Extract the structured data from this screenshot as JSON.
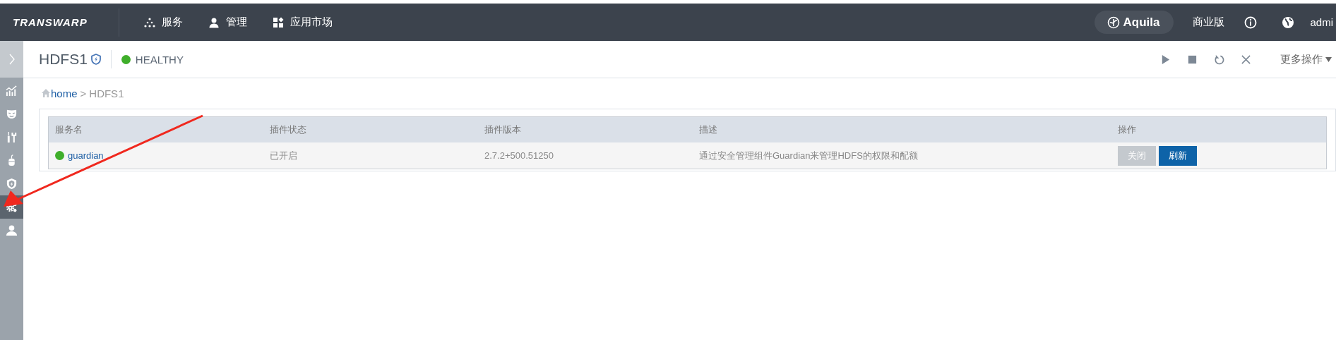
{
  "top_bar": {
    "logo": "TRANSWARP",
    "nav": [
      {
        "label": "服务"
      },
      {
        "label": "管理"
      },
      {
        "label": "应用市场"
      }
    ],
    "product": "Aquila",
    "edition": "商业版",
    "user": "admi"
  },
  "sidebar": {
    "items": [
      {
        "selected": false
      },
      {
        "selected": false
      },
      {
        "selected": false
      },
      {
        "selected": false
      },
      {
        "selected": false
      },
      {
        "selected": true
      },
      {
        "selected": false
      }
    ]
  },
  "header": {
    "title": "HDFS1",
    "status": "HEALTHY",
    "more": "更多操作"
  },
  "breadcrumb": {
    "home": "home",
    "separator": ">",
    "current": "HDFS1"
  },
  "table": {
    "columns": [
      "服务名",
      "插件状态",
      "插件版本",
      "描述",
      "操作"
    ],
    "rows": [
      {
        "color": "#3fae2a",
        "name": "guardian",
        "state": "已开启",
        "version": "2.7.2+500.51250",
        "description": "通过安全管理组件Guardian来管理HDFS的权限和配额",
        "buttons": [
          {
            "label": "关闭",
            "disabled": true
          },
          {
            "label": "刷新",
            "disabled": false
          }
        ]
      }
    ]
  },
  "annotation": {
    "kind": "arrow"
  }
}
